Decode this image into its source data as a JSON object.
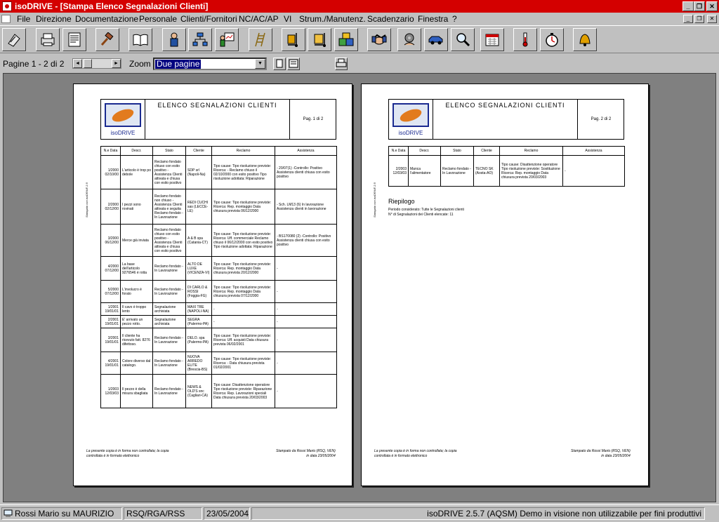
{
  "window": {
    "title": "isoDRIVE - [Stampa Elenco Segnalazioni Clienti]"
  },
  "menu": [
    "File",
    "Direzione",
    "Documentazione",
    "Personale",
    "Clienti/Fornitori",
    "NC/AC/AP",
    "VI",
    "Strum./Manutenz.",
    "Scadenzario",
    "Finestra",
    "?"
  ],
  "toolbar_icons": [
    "flag-icon",
    "printer-icon",
    "document-icon",
    "gavel-icon",
    "book-icon",
    "person-icon",
    "org-chart-icon",
    "presenter-icon",
    "ladder-icon",
    "hand-truck-icon",
    "boxes-icon",
    "handshake-icon",
    "gear-hand-icon",
    "car-icon",
    "magnifier-icon",
    "calendar-icon",
    "thermometer-icon",
    "stopwatch-icon",
    "bell-icon"
  ],
  "preview_bar": {
    "pages_label": "Pagine 1 - 2 di 2",
    "zoom_label": "Zoom",
    "zoom_value": "Due pagine"
  },
  "report": {
    "title": "ELENCO SEGNALAZIONI CLIENTI",
    "logo_text": "isoDRIVE",
    "side_text": "Stampato con isoDRIVE 2.5",
    "page1_label": "Pag. 1 di 2",
    "page2_label": "Pag. 2 di 2",
    "columns": [
      "N.e Data",
      "Descr.",
      "Stato",
      "Cliente",
      "Reclamo",
      "Assistenza"
    ],
    "rows": [
      {
        "num": "1/2000",
        "date": "02/10/00",
        "descr": "L'articolo è trop po debole",
        "stato": "Reclamo fondato chiuso con esito positivo - Assistenza Clienti attivata e chiusa con esito positivo",
        "cliente": "SDP srl (Napoli-Na)",
        "reclamo": "Tipo cause: Tipo risoluzione previste: Ricerca: - Reclamo chiuso il 02/10/2000 con esito positivo Tipo risoluzione adottata: Riparazione",
        "assistenza": "- 20/07(1) -Controllo: Positivo Assistenza clienti chiusa con esito positivo"
      },
      {
        "num": "2/2000",
        "date": "02/12/00",
        "descr": "I pezzi sono rovinati",
        "stato": "Reclamo fondato non chiuso - Assistenza Clienti attivata e seguita Reclamo fondato - In Lavorazione",
        "cliente": "REDI CUCHI sas (LECCE-LE)",
        "reclamo": "Tipo cause: Tipo risoluzione previste: Ricerca: Rep. montaggio Data chiusura prevista 06/12/2000",
        "assistenza": "- Sch. LM13 (6) In lavorazione Assistenza clienti in lavorazione"
      },
      {
        "num": "3/2000",
        "date": "06/12/00",
        "descr": "Merce già inviata",
        "stato": "Reclamo fondato chiuso con esito positivo - Assistenza Clienti attivata e chiusa con esito positivo",
        "cliente": "A & B spa (Catania-CT)",
        "reclamo": "Tipo cause: Tipo risoluzione previste: Ricerca: Uff. commerciale Reclamo chiuso il 06/12/2000 con esito positivo Tipo risoluzione adottata: Riparazione",
        "assistenza": "- BS170080 (2) -Controllo: Positivo Assistenza clienti chiusa con esito positivo"
      },
      {
        "num": "4/2000",
        "date": "07/12/00",
        "descr": "La base dell'articolo 9276546 è rotta",
        "stato": "Reclamo fondato - In Lavorazione",
        "cliente": "ALTO DE LUXE (VICENZA-VI)",
        "reclamo": "Tipo cause: Tipo risoluzione previste: Ricerca: Rep. montaggio Data chiusura prevista 20/12/2000",
        "assistenza": "-"
      },
      {
        "num": "5/2000",
        "date": "07/12/00",
        "descr": "L'involucro è forato",
        "stato": "Reclamo fondato - In Lavorazione",
        "cliente": "DI CARLO & ROSSI (Foggia-FG)",
        "reclamo": "Tipo cause: Tipo risoluzione previste: Ricerca: Rep. montaggio Data chiusura prevista 07/12/2000",
        "assistenza": "-"
      },
      {
        "num": "1/2001",
        "date": "19/01/01",
        "descr": "Il cavo è troppo lento",
        "stato": "Segnalazione archiviata",
        "cliente": "MAXI TRE (NAPOLI-NA)",
        "reclamo": "-",
        "assistenza": "-"
      },
      {
        "num": "2/2001",
        "date": "19/01/01",
        "descr": "E' arrivato un pezzo rotto.",
        "stato": "Segnalazione archiviata",
        "cliente": "SEGRA (Palermo-PA)",
        "reclamo": "-",
        "assistenza": "-"
      },
      {
        "num": "3/2001",
        "date": "19/01/01",
        "descr": "Il cliente ha ricevuto fatt. 8276 difettoso.",
        "stato": "Reclamo fondato - In Lavorazione",
        "cliente": "DELO. spa (Palermo-PA)",
        "reclamo": "Tipo cause: Tipo risoluzione previste: Ricerca: Uff. acquisti Data chiusura prevista 06/02/2001",
        "assistenza": "-"
      },
      {
        "num": "4/2001",
        "date": "19/01/01",
        "descr": "Colore diverso dal catalogo.",
        "stato": "Reclamo fondato - In Lavorazione",
        "cliente": "NUOVA ARREDO ELITE (Brescia-BS)",
        "reclamo": "Tipo cause: Tipo risoluzione previste: Ricerca: - Data chiusura prevista 01/02/2001",
        "assistenza": "-"
      },
      {
        "num": "1/2003",
        "date": "12/03/03",
        "descr": "Il pezzo è della misura sbagliata",
        "stato": "Reclamo fondato - In Lavorazione",
        "cliente": "NEWS & OLD'S snc (Cagliari-CA)",
        "reclamo": "Tipo cause: Disattenzione operatore Tipo risoluzione previste: Riparazione Ricerca: Rep. Lavorazioni speciali Data chiusura prevista 20/03/2003",
        "assistenza": "-"
      }
    ],
    "rows_page2": [
      {
        "num": "2/2003",
        "date": "12/03/03",
        "descr": "Manca l'alimentatore",
        "stato": "Reclamo fondato - In Lavorazione",
        "cliente": "TECNO SK (Aosta-AO)",
        "reclamo": "Tipo cause: Disattenzione operatore Tipo risoluzione previste: Sostituzione Ricerca: Rep. montaggio Data chiusura prevista 20/03/2003",
        "assistenza": "-"
      }
    ],
    "riepilogo_title": "Riepilogo",
    "riepilogo_period": "Periodo considerato: Tutte le Segnalazioni clienti",
    "riepilogo_count": "N° di Segnalazioni dei Clienti elencate: 11",
    "footer_left1": "La presente copia è in forma non controllata; la copia",
    "footer_left2": "controllata è in formato elettronico",
    "footer_right1": "Stampato da Rossi Mario (RSQ, VEN)",
    "footer_right2": "in data 23/05/2004"
  },
  "statusbar": {
    "user": "Rossi Mario su MAURIZIO",
    "role": "RSQ/RGA/RSS",
    "date": "23/05/2004",
    "version": "isoDRIVE 2.5.7 (AQSM) Demo in visione non utilizzabile per fini produttivi"
  }
}
